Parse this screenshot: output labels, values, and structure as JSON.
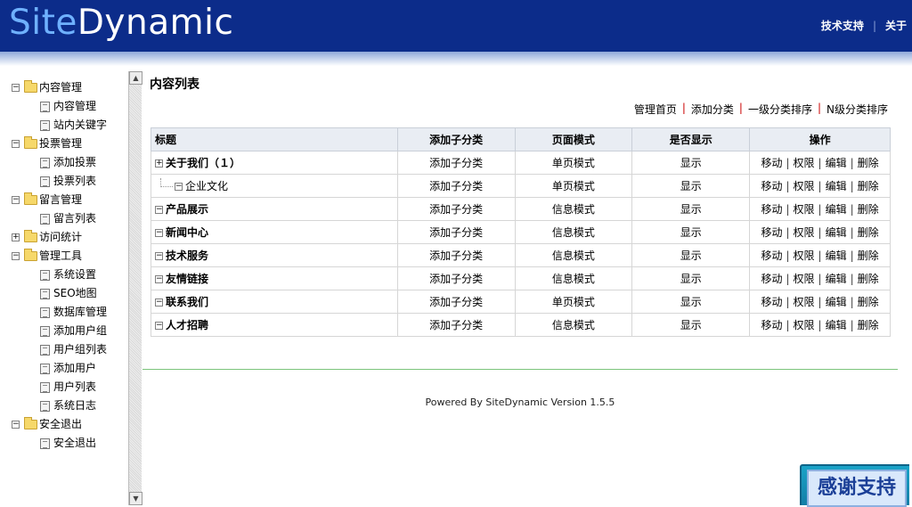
{
  "header": {
    "logo_part1": "Site",
    "logo_part2": "Dynamic",
    "links": [
      "技术支持",
      "关于"
    ]
  },
  "sidebar": {
    "groups": [
      {
        "label": "内容管理",
        "expanded": true,
        "items": [
          "内容管理",
          "站内关键字"
        ]
      },
      {
        "label": "投票管理",
        "expanded": true,
        "items": [
          "添加投票",
          "投票列表"
        ]
      },
      {
        "label": "留言管理",
        "expanded": true,
        "items": [
          "留言列表"
        ]
      },
      {
        "label": "访问统计",
        "expanded": false,
        "items": []
      },
      {
        "label": "管理工具",
        "expanded": true,
        "items": [
          "系统设置",
          "SEO地图",
          "数据库管理",
          "添加用户组",
          "用户组列表",
          "添加用户",
          "用户列表",
          "系统日志"
        ]
      },
      {
        "label": "安全退出",
        "expanded": true,
        "items": [
          "安全退出"
        ]
      }
    ]
  },
  "main": {
    "title": "内容列表",
    "toolbar": [
      "管理首页",
      "添加分类",
      "一级分类排序",
      "N级分类排序"
    ],
    "columns": [
      "标题",
      "添加子分类",
      "页面模式",
      "是否显示",
      "操作"
    ],
    "rows": [
      {
        "title": "关于我们（１）",
        "expander": "plus",
        "child": false,
        "add": "添加子分类",
        "mode": "单页模式",
        "show": "显示"
      },
      {
        "title": "企业文化",
        "expander": "minus",
        "child": true,
        "add": "添加子分类",
        "mode": "单页模式",
        "show": "显示"
      },
      {
        "title": "产品展示",
        "expander": "minus",
        "child": false,
        "add": "添加子分类",
        "mode": "信息模式",
        "show": "显示"
      },
      {
        "title": "新闻中心",
        "expander": "minus",
        "child": false,
        "add": "添加子分类",
        "mode": "信息模式",
        "show": "显示"
      },
      {
        "title": "技术服务",
        "expander": "minus",
        "child": false,
        "add": "添加子分类",
        "mode": "信息模式",
        "show": "显示"
      },
      {
        "title": "友情链接",
        "expander": "minus",
        "child": false,
        "add": "添加子分类",
        "mode": "信息模式",
        "show": "显示"
      },
      {
        "title": "联系我们",
        "expander": "minus",
        "child": false,
        "add": "添加子分类",
        "mode": "单页模式",
        "show": "显示"
      },
      {
        "title": "人才招聘",
        "expander": "minus",
        "child": false,
        "add": "添加子分类",
        "mode": "信息模式",
        "show": "显示"
      }
    ],
    "ops": [
      "移动",
      "权限",
      "编辑",
      "删除"
    ]
  },
  "footer": {
    "text": "Powered By SiteDynamic Version 1.5.5"
  },
  "support_badge": {
    "label": "感谢支持"
  },
  "colors": {
    "header_bg": "#0c2c8a",
    "logo_accent": "#6fb1ff",
    "toolbar_separator": "#cc0000",
    "footer_line": "#7cc47c"
  }
}
